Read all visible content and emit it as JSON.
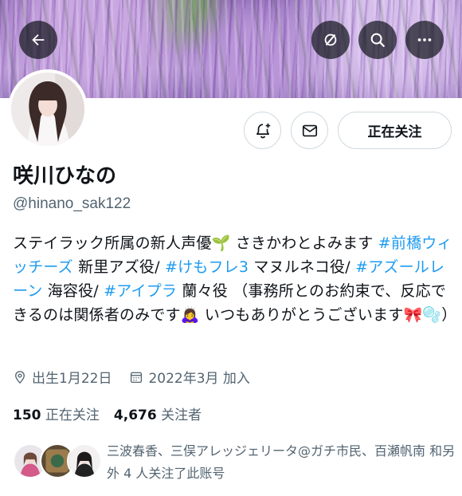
{
  "header": {
    "back_icon": "arrow-left-icon",
    "grok_icon": "grok-icon",
    "search_icon": "search-icon",
    "more_icon": "more-horizontal-icon"
  },
  "actions": {
    "notify_icon": "bell-plus-icon",
    "message_icon": "envelope-icon",
    "follow_label": "正在关注"
  },
  "profile": {
    "display_name": "咲川ひなの",
    "handle": "@hinano_sak122",
    "bio": [
      {
        "text": "ステイラック所属の新人声優🌱 さきかわとよみます ",
        "tag": false
      },
      {
        "text": "#前橋ウィッチーズ",
        "tag": true
      },
      {
        "text": " 新里アズ役/ ",
        "tag": false
      },
      {
        "text": "#けもフレ3",
        "tag": true
      },
      {
        "text": " マヌルネコ役/ ",
        "tag": false
      },
      {
        "text": "#アズールレーン",
        "tag": true
      },
      {
        "text": " 海容役/ ",
        "tag": false
      },
      {
        "text": "#アイプラ",
        "tag": true
      },
      {
        "text": " 蘭々役 （事務所とのお約束で、反応できるのは関係者のみです🙇‍♀️ いつもありがとうございます🎀🫧）",
        "tag": false
      }
    ],
    "birthday": "出生1月22日",
    "joined": "2022年3月 加入",
    "birthday_icon": "location-pin-icon",
    "joined_icon": "calendar-icon"
  },
  "stats": {
    "following_count": "150",
    "following_label": "正在关注",
    "followers_count": "4,676",
    "followers_label": "关注者"
  },
  "followed_by": {
    "text": "三波春香、三俣アレッジェリータ@ガチ市民、百瀬帆南 和另外 4 人关注了此账号"
  },
  "colors": {
    "link": "#1d9bf0",
    "secondary_text": "#536471",
    "primary_text": "#0f1419",
    "border": "#cfd9de"
  }
}
